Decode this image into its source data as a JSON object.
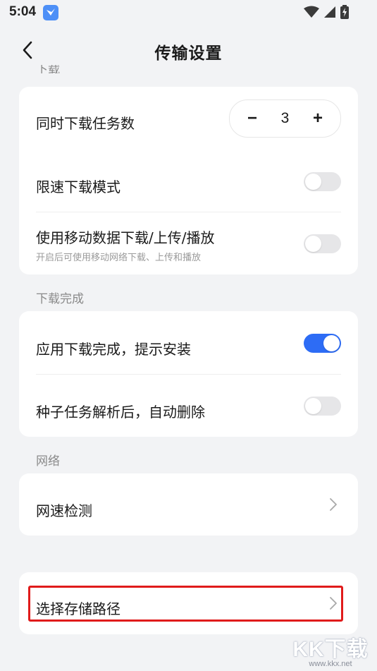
{
  "status_bar": {
    "time": "5:04",
    "icons": [
      "app-notification-icon",
      "wifi-icon",
      "signal-icon",
      "battery-charging-icon"
    ]
  },
  "header": {
    "title": "传输设置",
    "back_icon": "chevron-left-icon"
  },
  "sections": {
    "download": {
      "label": "下载",
      "concurrent_tasks_label": "同时下载任务数",
      "concurrent_tasks_value": "3",
      "decrement_label": "−",
      "increment_label": "+",
      "speed_limit_label": "限速下载模式",
      "speed_limit_on": false,
      "mobile_data_label": "使用移动数据下载/上传/播放",
      "mobile_data_sub": "开启后可使用移动网络下载、上传和播放",
      "mobile_data_on": false
    },
    "download_complete": {
      "label": "下载完成",
      "prompt_install_label": "应用下载完成，提示安装",
      "prompt_install_on": true,
      "torrent_delete_label": "种子任务解析后，自动删除",
      "torrent_delete_on": false
    },
    "network": {
      "label": "网络",
      "speed_test_label": "网速检测"
    },
    "storage": {
      "path_label": "选择存储路径"
    }
  },
  "colors": {
    "accent": "#2d6cf5",
    "highlight": "#e01b1b",
    "background": "#f2f3f5"
  },
  "watermark": {
    "brand": "KK下载",
    "url": "www.kkx.net"
  }
}
